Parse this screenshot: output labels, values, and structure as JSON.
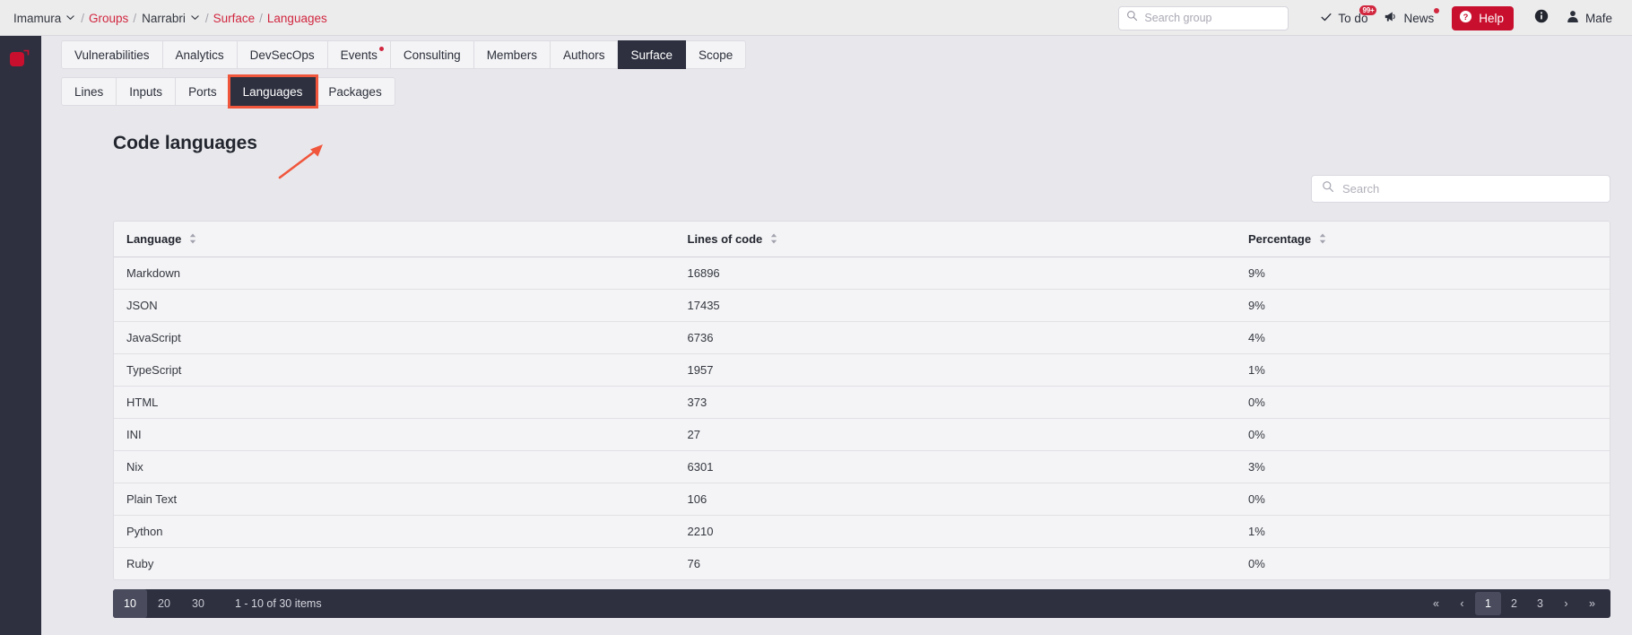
{
  "breadcrumb": {
    "items": [
      {
        "label": "Imamura",
        "type": "plain",
        "caret": true
      },
      {
        "label": "Groups",
        "type": "link",
        "caret": false
      },
      {
        "label": "Narrabri",
        "type": "plain",
        "caret": true
      },
      {
        "label": "Surface",
        "type": "link",
        "caret": false
      },
      {
        "label": "Languages",
        "type": "link",
        "caret": false
      }
    ],
    "separator": "/"
  },
  "header": {
    "group_search_placeholder": "Search group",
    "todo_label": "To do",
    "todo_badge": "99+",
    "news_label": "News",
    "help_label": "Help",
    "user_label": "Mafe"
  },
  "tabs": {
    "primary": [
      {
        "label": "Vulnerabilities",
        "active": false,
        "dot": false
      },
      {
        "label": "Analytics",
        "active": false,
        "dot": false
      },
      {
        "label": "DevSecOps",
        "active": false,
        "dot": false
      },
      {
        "label": "Events",
        "active": false,
        "dot": true
      },
      {
        "label": "Consulting",
        "active": false,
        "dot": false
      },
      {
        "label": "Members",
        "active": false,
        "dot": false
      },
      {
        "label": "Authors",
        "active": false,
        "dot": false
      },
      {
        "label": "Surface",
        "active": true,
        "dot": false
      },
      {
        "label": "Scope",
        "active": false,
        "dot": false
      }
    ],
    "secondary": [
      {
        "label": "Lines",
        "active": false,
        "highlighted": false
      },
      {
        "label": "Inputs",
        "active": false,
        "highlighted": false
      },
      {
        "label": "Ports",
        "active": false,
        "highlighted": false
      },
      {
        "label": "Languages",
        "active": true,
        "highlighted": true
      },
      {
        "label": "Packages",
        "active": false,
        "highlighted": false
      }
    ]
  },
  "main": {
    "title": "Code languages",
    "search_placeholder": "Search",
    "table": {
      "columns": [
        {
          "label": "Language",
          "sortable": true
        },
        {
          "label": "Lines of code",
          "sortable": true
        },
        {
          "label": "Percentage",
          "sortable": true
        }
      ],
      "rows": [
        {
          "language": "Markdown",
          "lines": "16896",
          "percentage": "9%"
        },
        {
          "language": "JSON",
          "lines": "17435",
          "percentage": "9%"
        },
        {
          "language": "JavaScript",
          "lines": "6736",
          "percentage": "4%"
        },
        {
          "language": "TypeScript",
          "lines": "1957",
          "percentage": "1%"
        },
        {
          "language": "HTML",
          "lines": "373",
          "percentage": "0%"
        },
        {
          "language": "INI",
          "lines": "27",
          "percentage": "0%"
        },
        {
          "language": "Nix",
          "lines": "6301",
          "percentage": "3%"
        },
        {
          "language": "Plain Text",
          "lines": "106",
          "percentage": "0%"
        },
        {
          "language": "Python",
          "lines": "2210",
          "percentage": "1%"
        },
        {
          "language": "Ruby",
          "lines": "76",
          "percentage": "0%"
        }
      ]
    }
  },
  "pagination": {
    "page_sizes": [
      {
        "label": "10",
        "active": true
      },
      {
        "label": "20",
        "active": false
      },
      {
        "label": "30",
        "active": false
      }
    ],
    "info": "1 - 10 of 30 items",
    "first_label": "«",
    "prev_label": "‹",
    "next_label": "›",
    "last_label": "»",
    "pages": [
      {
        "label": "1",
        "active": true
      },
      {
        "label": "2",
        "active": false
      },
      {
        "label": "3",
        "active": false
      }
    ]
  },
  "colors": {
    "accent_red": "#d1273f",
    "help_red": "#c8102e",
    "dark": "#2e3040",
    "annotation": "#f0563c",
    "page_bg": "#e8e8ec"
  }
}
